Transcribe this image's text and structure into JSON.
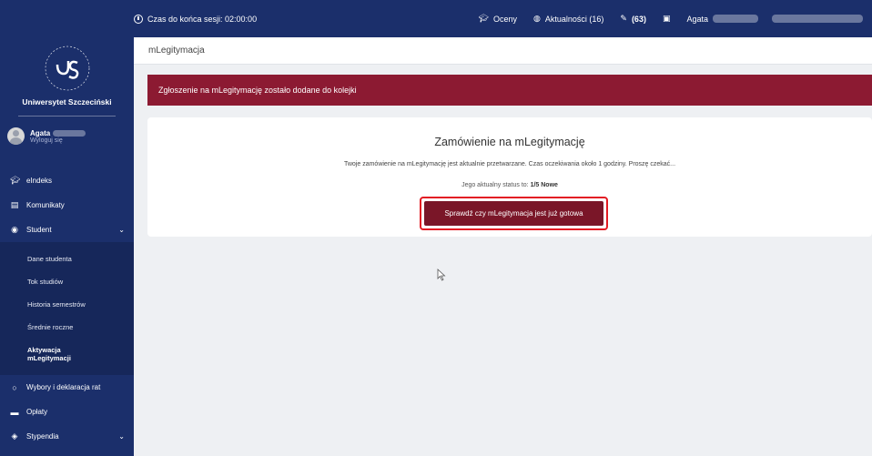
{
  "topbar": {
    "session_label": "Czas do końca sesji: 02:00:00",
    "grades": "Oceny",
    "news": "Aktualności (16)",
    "messages": "(63)",
    "user_first": "Agata"
  },
  "sidebar": {
    "university": "Uniwersytet Szczeciński",
    "user_name": "Agata",
    "logout": "Wyloguj się",
    "items": [
      {
        "label": "eIndeks",
        "icon": "graduation-cap-icon"
      },
      {
        "label": "Komunikaty",
        "icon": "document-icon"
      },
      {
        "label": "Student",
        "icon": "student-icon"
      }
    ],
    "student_sub": [
      {
        "label": "Dane studenta"
      },
      {
        "label": "Tok studiów"
      },
      {
        "label": "Historia semestrów"
      },
      {
        "label": "Średnie roczne"
      },
      {
        "label": "Aktywacja mLegitymacji"
      }
    ],
    "items_after": [
      {
        "label": "Wybory i deklaracja rat",
        "icon": "chat-icon"
      },
      {
        "label": "Opłaty",
        "icon": "money-icon"
      },
      {
        "label": "Stypendia",
        "icon": "tag-icon"
      }
    ]
  },
  "breadcrumb": "mLegitymacja",
  "alert": "Zgłoszenie na mLegitymację zostało dodane do kolejki",
  "card": {
    "title": "Zamówienie na mLegitymację",
    "description": "Twoje zamówienie na mLegitymację jest aktualnie przetwarzane. Czas oczekiwania około 1 godziny. Proszę czekać...",
    "status_prefix": "Jego aktualny status to:",
    "status_value": "1/5 Nowe",
    "button": "Sprawdź czy mLegitymacja jest już gotowa"
  },
  "colors": {
    "sidebar": "#1b2f6b",
    "alert": "#8c1a32",
    "button": "#7a1628",
    "highlight": "#e31b23"
  }
}
